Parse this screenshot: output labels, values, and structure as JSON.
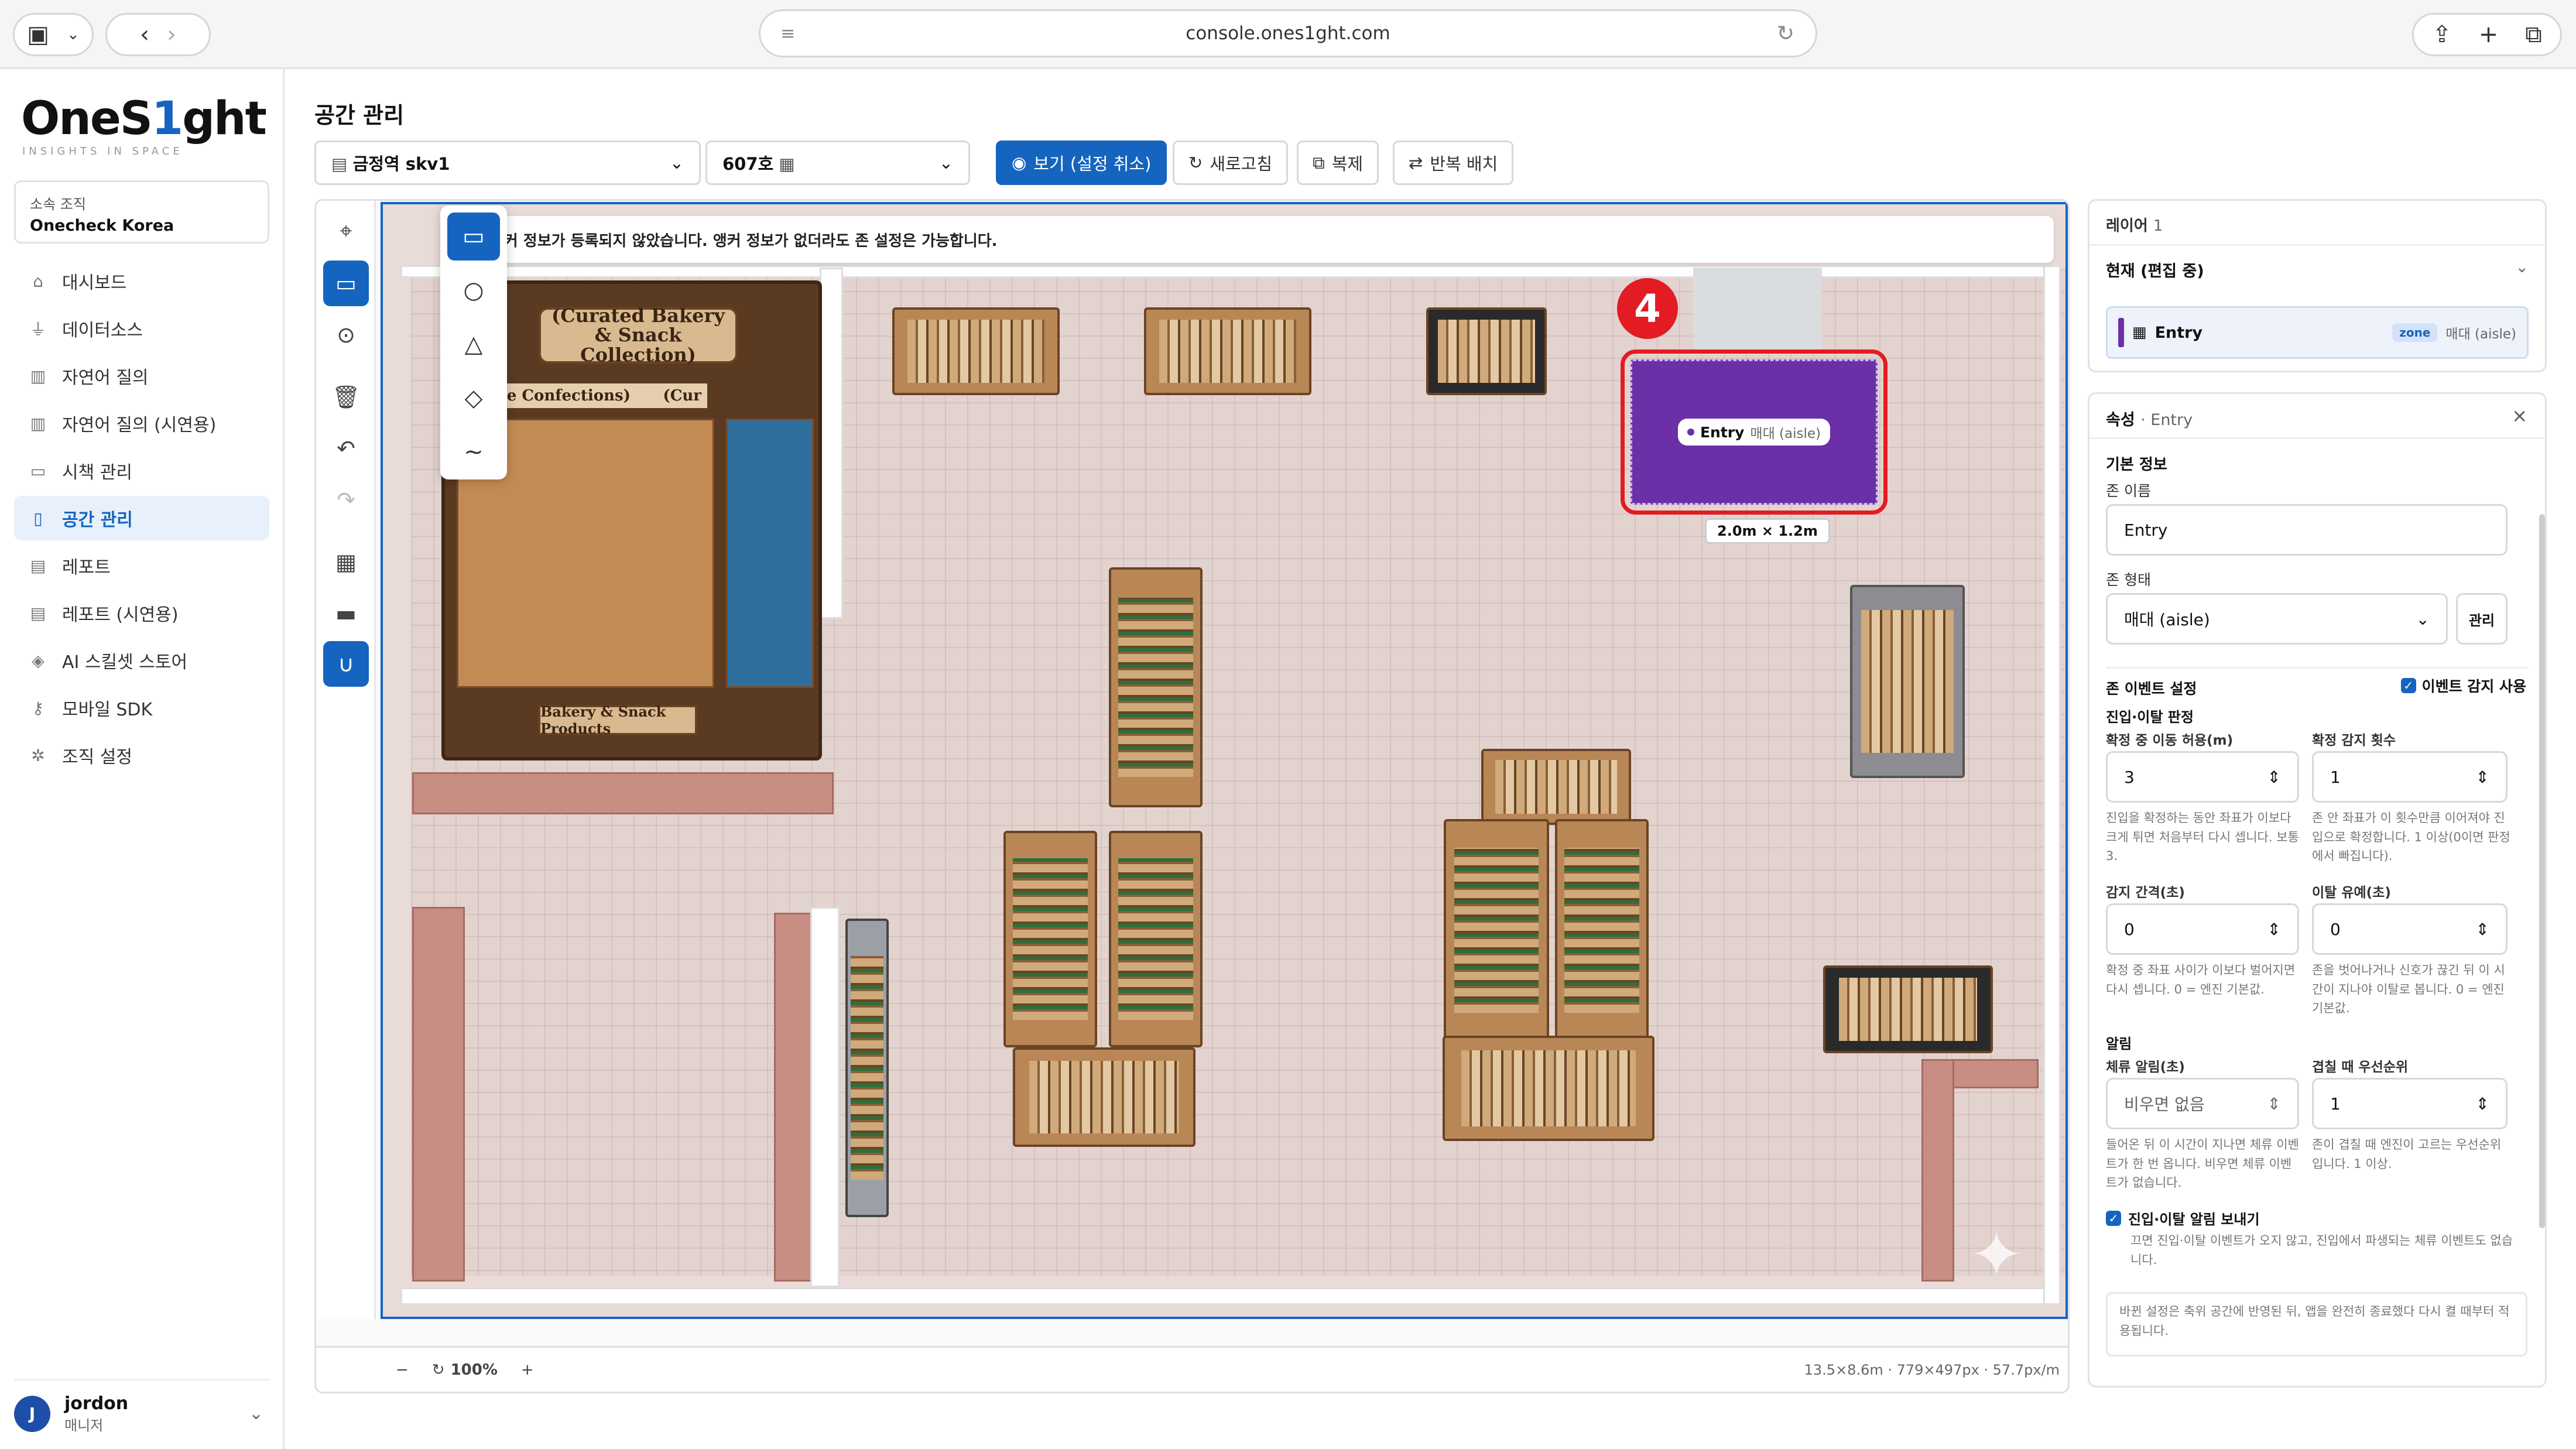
{
  "browser": {
    "url": "console.ones1ght.com"
  },
  "brand": {
    "name_pre": "OneS",
    "name_mid": "1",
    "name_post": "ght",
    "tagline": "INSIGHTS IN SPACE"
  },
  "org": {
    "label": "소속 조직",
    "value": "Onecheck Korea"
  },
  "nav": [
    {
      "label": "대시보드",
      "icon": "home-icon"
    },
    {
      "label": "데이터소스",
      "icon": "plug-icon"
    },
    {
      "label": "자연어 질의",
      "icon": "bar-chart-icon"
    },
    {
      "label": "자연어 질의 (시연용)",
      "icon": "bar-chart-icon"
    },
    {
      "label": "시책 관리",
      "icon": "briefcase-icon"
    },
    {
      "label": "공간 관리",
      "icon": "map-icon",
      "active": true
    },
    {
      "label": "레포트",
      "icon": "document-icon"
    },
    {
      "label": "레포트 (시연용)",
      "icon": "document-icon"
    },
    {
      "label": "AI 스킬셋 스토어",
      "icon": "cube-icon"
    },
    {
      "label": "모바일 SDK",
      "icon": "key-icon"
    },
    {
      "label": "조직 설정",
      "icon": "gear-icon"
    }
  ],
  "user": {
    "initial": "J",
    "name": "jordon",
    "role": "매니저"
  },
  "page": {
    "title": "공간 관리"
  },
  "toolbar": {
    "site": "금정역 skv1",
    "floor": "607호",
    "view": "보기 (설정 취소)",
    "refresh": "새로고침",
    "copy": "복제",
    "repeat": "반복 배치"
  },
  "notice": "층에 앵커 정보가 등록되지 않았습니다. 앵커 정보가 없더라도 존 설정은 가능합니다.",
  "map": {
    "bakery_title": "(Curated Bakery & Snack Collection)",
    "bakery_sub": "& Fine Confections)",
    "bakery_sub2": "(Cur",
    "bakery_bottom": "Bakery & Snack Products",
    "step_badge": "4",
    "zone": {
      "name": "Entry",
      "type": "매대 (aisle)",
      "size": "2.0m × 1.2m"
    }
  },
  "footer": {
    "zoom": "100%",
    "info": "13.5×8.6m · 779×497px · 57.7px/m"
  },
  "layers": {
    "title": "레이어",
    "count": "1",
    "current": "현재 (편집 중)",
    "item_name": "Entry",
    "item_badge": "zone",
    "item_type": "매대 (aisle)"
  },
  "props": {
    "title": "속성",
    "subtitle": "· Entry",
    "basic": "기본 정보",
    "zone_name_label": "존 이름",
    "zone_name": "Entry",
    "zone_type_label": "존 형태",
    "zone_type": "매대 (aisle)",
    "manage": "관리",
    "events_title": "존 이벤트 설정",
    "events_toggle": "이벤트 감지 사용",
    "entry_exit": "진입·이탈 판정",
    "move_label": "확정 중 이동 허용(m)",
    "move_value": "3",
    "detect_label": "확정 감지 횟수",
    "detect_value": "1",
    "move_hint": "진입을 확정하는 동안 좌표가 이보다 크게 튀면 처음부터 다시 셉니다. 보통 3.",
    "detect_hint": "존 안 좌표가 이 횟수만큼 이어져야 진입으로 확정합니다. 1 이상(0이면 판정에서 빠집니다).",
    "interval_label": "감지 간격(초)",
    "interval_value": "0",
    "grace_label": "이탈 유예(초)",
    "grace_value": "0",
    "interval_hint": "확정 중 좌표 사이가 이보다 벌어지면 다시 셉니다. 0 = 엔진 기본값.",
    "grace_hint": "존을 벗어나거나 신호가 끊긴 뒤 이 시간이 지나야 이탈로 봅니다. 0 = 엔진 기본값.",
    "alarm": "알림",
    "dwell_label": "체류 알림(초)",
    "dwell_value": "비우면 없음",
    "priority_label": "겹칠 때 우선순위",
    "priority_value": "1",
    "dwell_hint": "들어온 뒤 이 시간이 지나면 체류 이벤트가 한 번 옵니다. 비우면 체류 이벤트가 없습니다.",
    "priority_hint": "존이 겹칠 때 엔진이 고르는 우선순위입니다. 1 이상.",
    "send_label": "진입·이탈 알림 보내기",
    "send_hint": "끄면 진입·이탈 이벤트가 오지 않고, 진입에서 파생되는 체류 이벤트도 없습니다.",
    "footer_note": "바뀐 설정은 축위 공간에 반영된 뒤, 앱을 완전히 종료했다 다시 켤 때부터 적용됩니다."
  }
}
